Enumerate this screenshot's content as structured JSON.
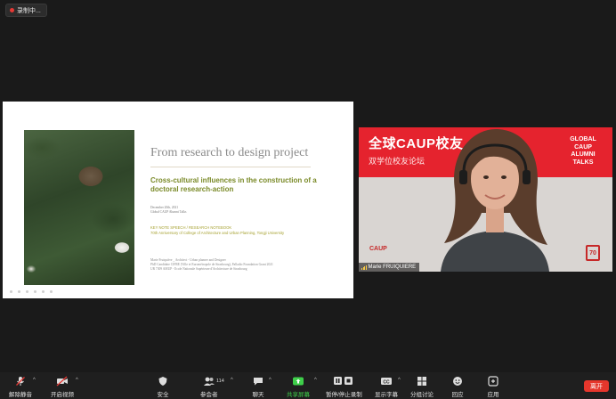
{
  "recording": {
    "label": "录制中..."
  },
  "slide": {
    "title": "From research to design project",
    "subtitle": "Cross-cultural influences in the construction of a doctoral research-action",
    "date_line1": "December 20th, 2021",
    "date_line2": "Global CAUP Alumni Talks",
    "keynote_line1": "KEY NOTE SPEECH / RESEARCH NOTEBOOK",
    "keynote_line2": "70th Anniversary of College of Architecture and Urban Planning, Tongji University",
    "speaker_line1": "Marie Fruiquière _ Architect - Urban planner and Designer",
    "speaker_line2": "PhD Candidate CIFRE (Ville et Eurométropole de Strasbourg), Palladio Foundation Grant 2021",
    "speaker_line3": "UR 7309 AMUP - Ecole Nationale Supérieure d'Architecture de Strasbourg"
  },
  "video": {
    "banner_cn": "全球CAUP校友",
    "banner_sub": "双学位校友论坛",
    "banner_right": "GLOBAL CAUP ALUMNI TALKS",
    "logo_left": "CAUP",
    "logo_right": "70",
    "participant_name": "Marie FRUIQUIERE"
  },
  "toolbar": {
    "mute_label": "解除静音",
    "video_label": "开启视频",
    "security_label": "安全",
    "participants_label": "参会者",
    "participants_count": "114",
    "chat_label": "聊天",
    "share_label": "共享屏幕",
    "record_label": "暂停/停止录制",
    "captions_label": "显示字幕",
    "breakout_label": "分组讨论",
    "reactions_label": "回应",
    "apps_label": "应用",
    "leave_label": "离开"
  },
  "colors": {
    "background": "#1a1a1a",
    "banner_red": "#e5232e",
    "slide_accent": "#7a8a28",
    "share_green": "#3ecf4a",
    "leave_red": "#e5362c"
  }
}
